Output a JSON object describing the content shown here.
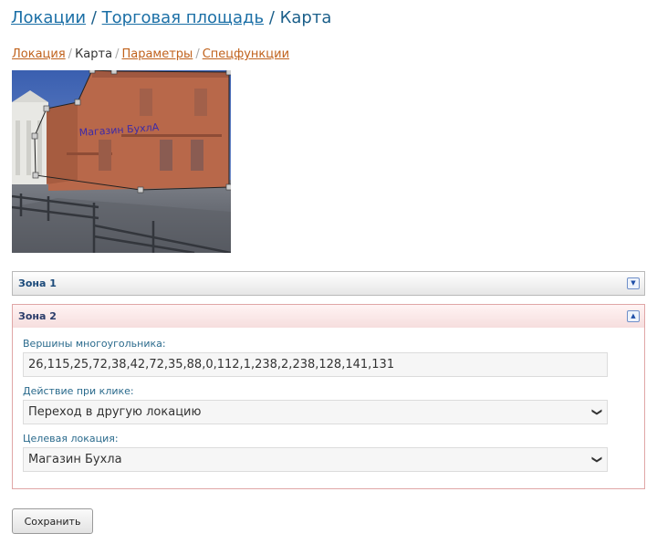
{
  "header": {
    "links": [
      "Локации",
      "Торговая площадь"
    ],
    "separator": "/",
    "current": "Карта"
  },
  "tabs": {
    "location": "Локация",
    "map": "Карта",
    "parameters": "Параметры",
    "special": "Спецфункции",
    "separator": "/"
  },
  "map": {
    "shop_sign": "Магазин БухлА"
  },
  "zones": [
    {
      "title": "Зона 1",
      "state": "collapsed"
    },
    {
      "title": "Зона 2",
      "state": "expanded",
      "vertices_label": "Вершины многоугольника:",
      "vertices_value": "26,115,25,72,38,42,72,35,88,0,112,1,238,2,238,128,141,131",
      "action_label": "Действие при клике:",
      "action_value": "Переход в другую локацию",
      "target_label": "Целевая локация:",
      "target_value": "Магазин Бухла"
    }
  ],
  "save_label": "Сохранить",
  "colors": {
    "link": "#1b6fa6",
    "tab_link": "#c0621c",
    "zone_active_border": "#e0a6a6"
  }
}
